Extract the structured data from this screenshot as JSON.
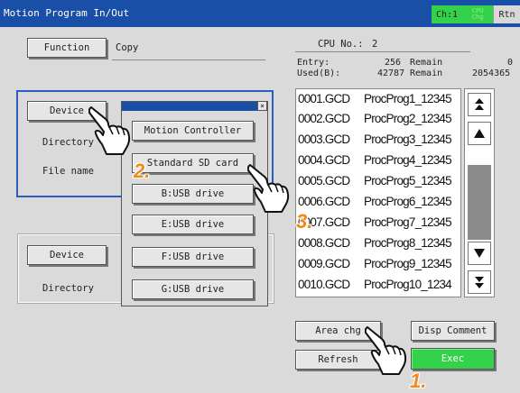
{
  "titlebar": {
    "title": "Motion Program In/Out",
    "ch_label": "Ch:1",
    "cpu_line1": "CPU",
    "cpu_line2": "Chg",
    "rtn_label": "Rtn"
  },
  "source": {
    "function_button": "Function",
    "function_value": "Copy",
    "device_button": "Device",
    "directory_label": "Directory",
    "filename_label": "File name"
  },
  "dest": {
    "device_button": "Device",
    "directory_label": "Directory"
  },
  "device_popup": {
    "close_glyph": "×",
    "options": [
      "Motion Controller",
      "Standard SD card",
      "B:USB drive",
      "E:USB drive",
      "F:USB drive",
      "G:USB drive"
    ]
  },
  "cpu_info": {
    "cpu_no_label": "CPU No.:",
    "cpu_no_value": "2",
    "entry_label": "Entry:",
    "entry_value": "256",
    "entry_remain_label": "Remain",
    "entry_remain_value": "0",
    "used_label": "Used(B):",
    "used_value": "42787",
    "used_remain_label": "Remain",
    "used_remain_value": "2054365"
  },
  "program_list": [
    {
      "file": "0001.GCD",
      "name": "ProcProg1_12345"
    },
    {
      "file": "0002.GCD",
      "name": "ProcProg2_12345"
    },
    {
      "file": "0003.GCD",
      "name": "ProcProg3_12345"
    },
    {
      "file": "0004.GCD",
      "name": "ProcProg4_12345"
    },
    {
      "file": "0005.GCD",
      "name": "ProcProg5_12345"
    },
    {
      "file": "0006.GCD",
      "name": "ProcProg6_12345"
    },
    {
      "file": "0007.GCD",
      "name": "ProcProg7_12345"
    },
    {
      "file": "0008.GCD",
      "name": "ProcProg8_12345"
    },
    {
      "file": "0009.GCD",
      "name": "ProcProg9_12345"
    },
    {
      "file": "0010.GCD",
      "name": "ProcProg10_1234"
    }
  ],
  "scrollbar": {
    "top_icon": "double-up-arrow",
    "up_icon": "up-arrow",
    "down_icon": "down-arrow",
    "bottom_icon": "double-down-arrow"
  },
  "actions": {
    "area_chg": "Area chg",
    "disp_comment": "Disp Comment",
    "refresh": "Refresh",
    "exec": "Exec"
  },
  "steps": {
    "one": "1.",
    "two": "2.",
    "three": "3."
  },
  "colors": {
    "title_bar": "#1a4fa8",
    "accent_green": "#33d24a",
    "frame_blue": "#2a5fc0",
    "step_orange": "#f08a1c",
    "panel_gray": "#dadada"
  }
}
